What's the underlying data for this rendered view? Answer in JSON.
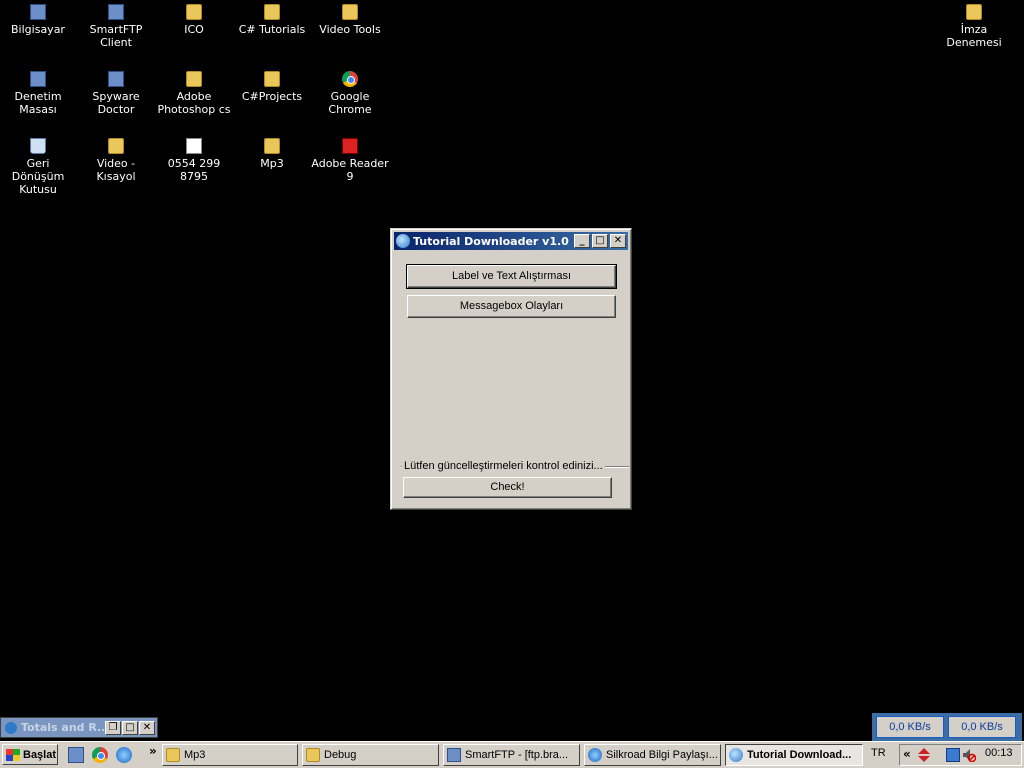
{
  "desktop": {
    "icons": [
      {
        "label": "Bilgisayar",
        "icon": "computer-icon"
      },
      {
        "label": "SmartFTP Client",
        "icon": "smartftp-icon"
      },
      {
        "label": "ICO",
        "icon": "folder-icon"
      },
      {
        "label": "C# Tutorials",
        "icon": "folder-icon"
      },
      {
        "label": "Video Tools",
        "icon": "folder-icon"
      },
      {
        "label": "İmza Denemesi",
        "icon": "folder-icon"
      },
      {
        "label": "Denetim Masası",
        "icon": "control-panel-icon"
      },
      {
        "label": "Spyware Doctor",
        "icon": "spyware-doctor-icon"
      },
      {
        "label": "Adobe Photoshop cs",
        "icon": "folder-icon"
      },
      {
        "label": "C#Projects",
        "icon": "folder-icon"
      },
      {
        "label": "Google Chrome",
        "icon": "chrome-icon"
      },
      {
        "label": "Geri Dönüşüm Kutusu",
        "icon": "recycle-bin-icon"
      },
      {
        "label": "Video - Kısayol",
        "icon": "shortcut-icon"
      },
      {
        "label": "0554 299 8795",
        "icon": "text-document-icon"
      },
      {
        "label": "Mp3",
        "icon": "folder-icon"
      },
      {
        "label": "Adobe Reader 9",
        "icon": "adobe-reader-icon"
      }
    ]
  },
  "window": {
    "title": "Tutorial Downloader v1.0",
    "button1": "Label ve Text Alıştırması",
    "button2": "Messagebox Olayları",
    "group_label": "Lütfen güncelleştirmeleri kontrol edinizi...",
    "check_button": "Check!",
    "minimize": "_",
    "maximize": "□",
    "close": "✕"
  },
  "mini_window": {
    "title": "Totals and R..."
  },
  "network": {
    "down": "0,0 KB/s",
    "up": "0,0 KB/s"
  },
  "taskbar": {
    "start_label": "Başlat",
    "chevron": "»",
    "tasks": [
      {
        "label": "Mp3"
      },
      {
        "label": "Debug"
      },
      {
        "label": "SmartFTP - [ftp.bra..."
      },
      {
        "label": "Silkroad Bilgi Paylaşı..."
      },
      {
        "label": "Tutorial Download..."
      }
    ],
    "language": "TR",
    "tray_chevron": "«",
    "clock": "00:13"
  },
  "colors": {
    "desktop_bg": "#000000",
    "titlebar_start": "#0a246a",
    "titlebar_end": "#3a6ea5",
    "face": "#d4d0c8"
  }
}
